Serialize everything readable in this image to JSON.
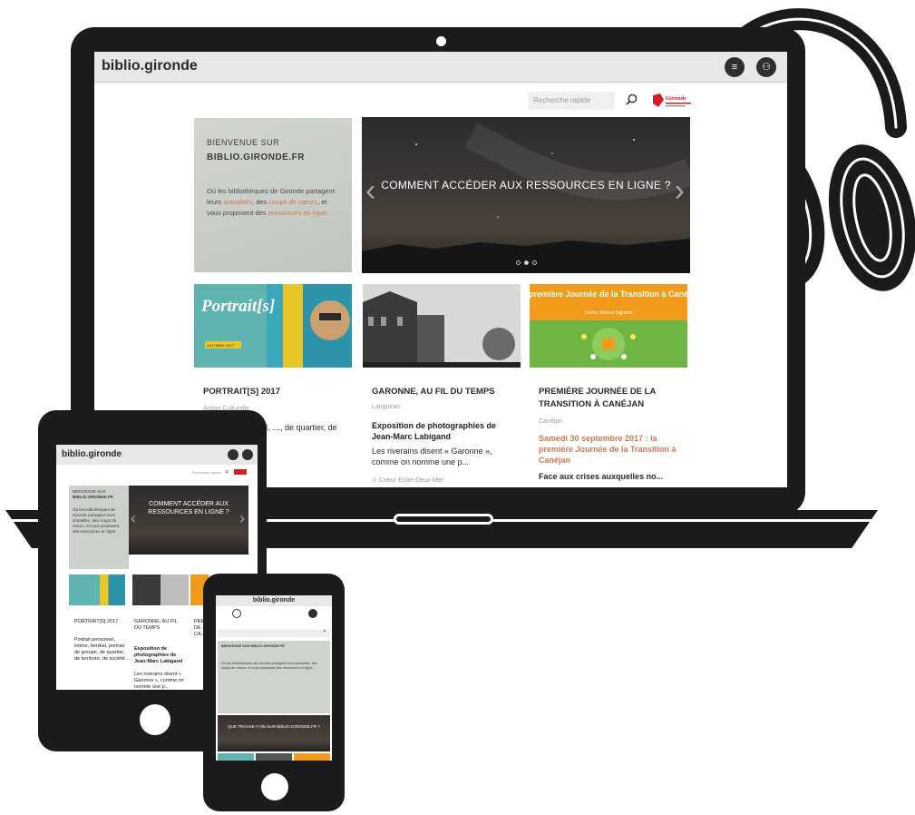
{
  "laptop": {
    "site_name": "biblio.gironde",
    "search_placeholder": "Recherche rapide",
    "gironde_logo_text": "Gironde",
    "welcome": {
      "title": "BIENVENUE SUR",
      "site": "BIBLIO.GIRONDE.FR",
      "body_1": "Où les bibliothèques de Gironde partagent leurs ",
      "body_hl_1": "actualités",
      "body_2": ", des ",
      "body_hl_2": "coups de cœurs",
      "body_3": ", et vous proposent des ",
      "body_hl_3": "ressources en ligne",
      "body_4": "."
    },
    "hero_title": "COMMENT ACCÉDER AUX RESSOURCES EN LIGNE ?",
    "cards": [
      {
        "title": "PORTRAIT[S] 2017",
        "location": "Action Culturelle",
        "text": "…, intime, familial, …, de quartier, de …",
        "img_title": "Portrait[s]",
        "img_badge": "AUTOMNE 2017"
      },
      {
        "title": "GARONNE, AU FIL DU TEMPS",
        "location": "Langoiran",
        "subtitle": "Exposition de photographies de Jean-Marc Labigand",
        "text": "Les riverains disent « Garonne », comme on nomme une p...",
        "footer": "Coeur-Entre-Deux-Mer"
      },
      {
        "title": "PREMIÈRE JOURNÉE DE LA TRANSITION À CANÉJAN",
        "location": "Canéjan",
        "subtitle": "Samedi 30 septembre 2017 : la première Journée de la Transition à Canéjan",
        "text": "Face aux crises auxquelles no...",
        "img_title": "La première Journée de la Transition à Canéjan",
        "img_sub": "Centre Simone Signoret"
      }
    ]
  },
  "tablet": {
    "site_name": "biblio.gironde",
    "search_placeholder": "Recherche rapide",
    "welcome_title": "BIENVENUE SUR",
    "welcome_site": "BIBLIO.GIRONDE.FR",
    "welcome_body": "Où les bibliothèques de Gironde partagent leurs actualités, des coups de cœurs, et vous proposent des ressources en ligne.",
    "hero_title": "COMMENT ACCÉDER AUX RESSOURCES EN LIGNE ?",
    "cards": [
      {
        "title": "PORTRAIT[S] 2017",
        "text": "Portrait personnel, intime, familial, portrait de groupe, de quartier, de territoire, de société..."
      },
      {
        "title": "GARONNE, AU FIL DU TEMPS",
        "subtitle": "Exposition de photographies de Jean-Marc Labigand",
        "text": "Les riverains disent « Garonne », comme on nomme une p..."
      },
      {
        "title": "PRE... DE ... CA..."
      }
    ]
  },
  "phone": {
    "site_name": "biblio.gironde",
    "welcome_title": "BIENVENUE SUR BIBLIO.GIRONDE.FR",
    "welcome_body": "Où les bibliothèques de Gironde partagent leurs actualités, des coups de cœurs, et vous proposent des ressources en ligne.",
    "hero_title": "QUE TROUVE-T-ON SUR BIBLIO.GIRONDE.FR ?"
  },
  "colors": {
    "device_body": "#1b1b1b",
    "highlight": "#c97a55",
    "hero_bg": "#2c2b2e",
    "card1_yellow": "#e7c62a",
    "card3_orange": "#f19a1b",
    "card3_green": "#6eb544"
  },
  "icons": [
    "search-icon",
    "menu-icon",
    "user-icon",
    "chevron-left-icon",
    "chevron-right-icon",
    "headphones-icon"
  ]
}
